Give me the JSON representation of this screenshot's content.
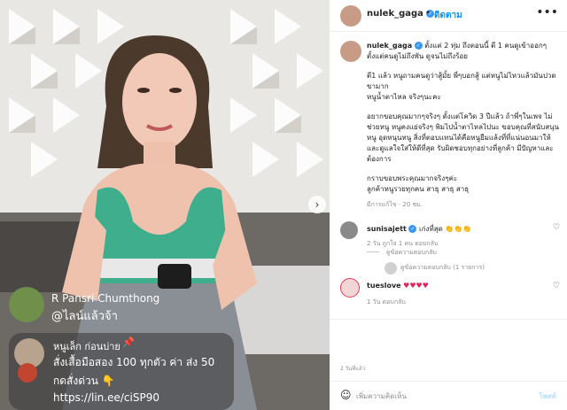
{
  "post": {
    "username": "nulek_gaga",
    "follow_label": "ติดตาม",
    "dot": "•",
    "more_icon": "•••"
  },
  "caption": {
    "username": "nulek_gaga",
    "line1": "ตั้งแต่ 2 ทุ่ม ถึงตอนนี้ ตี 1 คนดูเข้าออกๆ ตั้งแต่คนดูไม่ถึงพัน ดูจนไม่ถึงร้อย",
    "line2": "ตี1 แล้ว หนูถามคนดูว่าสู้มั้ย พี่ๆบอกสู้ แต่หนูไม่ไหวแล้วมันปวดขามาก",
    "line3": "หนูน้ำตาไหล จริงๆนะคะ",
    "line4": "อยากขอบคุณมากๆจริงๆ ตั้งแต่โควิด 3 ปีแล้ว ถ้าพี่ๆในเพจ ไม่ช่วยหนู หนูคงแย่จริงๆ พิมไปน้ำตาไหลไปนะ ขอบคุณที่สนับสนุนหนู อุดหนุนหนู สิ่งที่ตอบแทนได้คือหนูยืมแล้งที่ที่แน่นอนมาให้ และดูแลใจใส่ให้ดีที่สุด รับผิดชอบทุกอย่างที่ลูกค้า มีปัญหาและต้องการ",
    "line5": "กราบขอบพระคุณมากจริงๆค่ะ",
    "line6": "ลูกค้าหนูรวยทุกคน สาธุ สาธุ สาธุ",
    "meta": "มีการแก้ไข · 20 ชม."
  },
  "comments": [
    {
      "username": "sunisajett",
      "text": "เก่งที่สุด 👏👏👏",
      "meta": "2 วัน   ถูกใจ 1 คน   ตอบกลับ",
      "reply_toggle": "ดูข้อความตอบกลับ",
      "reply_count": "ดูข้อความตอบกลับ (1 รายการ)"
    },
    {
      "username": "tueslove",
      "text": "♥♥♥♥",
      "meta": "1 วัน   ตอบกลับ"
    }
  ],
  "actions": {
    "date": "2 วันที่แล้ว"
  },
  "footer": {
    "emoji_icon": "☺",
    "placeholder": "เพิ่มความคิดเห็น",
    "post_label": "โพสต์"
  },
  "media": {
    "next_icon": "›",
    "live_comment1": {
      "name": "R Pansri Chumthong",
      "message": "@ไลน์แล้วจ้า"
    },
    "live_comment2": {
      "name": "หนูเล็ก ก่อนบ่าย",
      "line1": "สั่งเสื้อมือสอง   100 ทุกตัว   ค่า ส่ง 50",
      "line2": "กดสั่งด่วน 👇",
      "line3": "https://lin.ee/ciSP90"
    }
  },
  "colors": {
    "accent": "#0095f6",
    "verified": "#3897f0"
  }
}
